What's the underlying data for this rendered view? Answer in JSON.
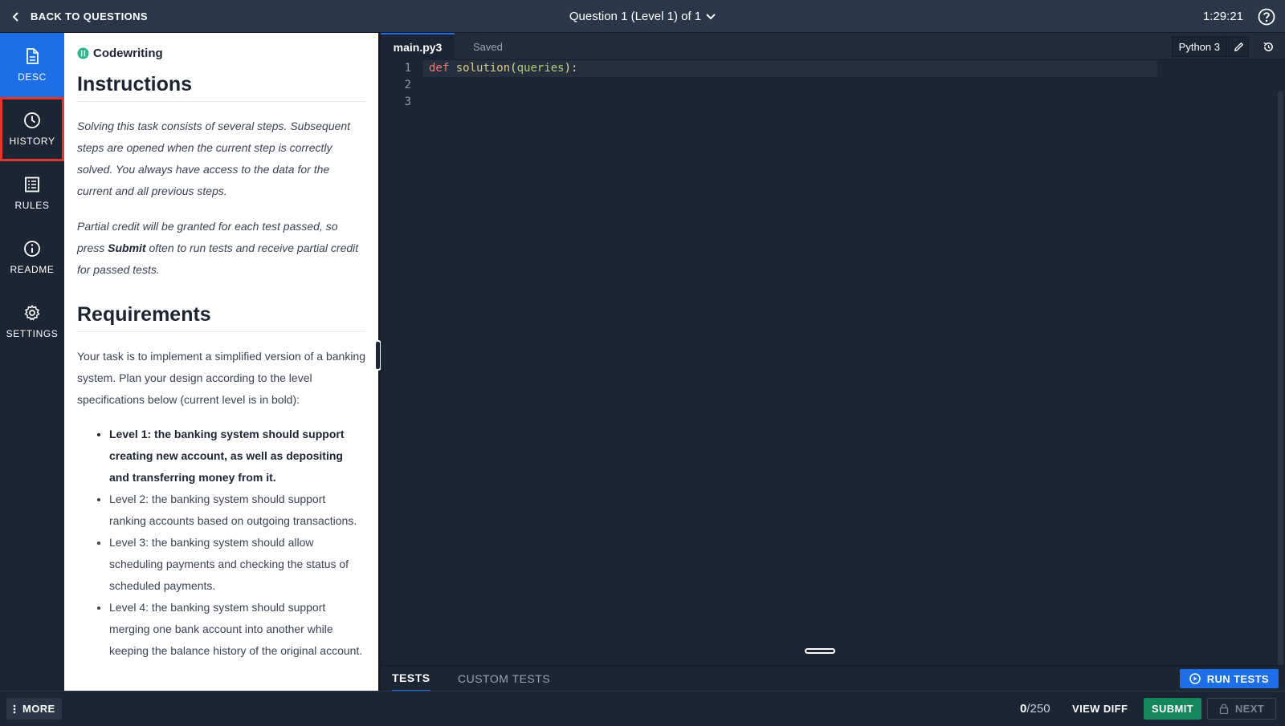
{
  "topbar": {
    "back_label": "BACK TO QUESTIONS",
    "question_title": "Question 1 (Level 1) of 1",
    "timer": "1:29:21"
  },
  "nav": {
    "items": [
      {
        "label": "DESC",
        "icon": "document-icon"
      },
      {
        "label": "HISTORY",
        "icon": "clock-icon"
      },
      {
        "label": "RULES",
        "icon": "list-icon"
      },
      {
        "label": "README",
        "icon": "info-icon"
      },
      {
        "label": "SETTINGS",
        "icon": "gear-icon"
      }
    ]
  },
  "desc": {
    "type_label": "Codewriting",
    "instructions_heading": "Instructions",
    "instructions_p1": "Solving this task consists of several steps. Subsequent steps are opened when the current step is correctly solved. You always have access to the data for the current and all previous steps.",
    "instructions_p2_before": "Partial credit will be granted for each test passed, so press ",
    "instructions_p2_bold": "Submit",
    "instructions_p2_after": " often to run tests and receive partial credit for passed tests.",
    "requirements_heading": "Requirements",
    "requirements_intro": "Your task is to implement a simplified version of a banking system. Plan your design according to the level specifications below (current level is in bold):",
    "levels": [
      "Level 1: the banking system should support creating new account, as well as depositing and transferring money from it.",
      "Level 2: the banking system should support ranking accounts based on outgoing transactions.",
      "Level 3: the banking system should allow scheduling payments and checking the status of scheduled payments.",
      "Level 4: the banking system should support merging one bank account into another while keeping the balance history of the original account."
    ]
  },
  "editor": {
    "filename": "main.py3",
    "save_status": "Saved",
    "language": "Python 3",
    "lines": [
      "1",
      "2",
      "3"
    ],
    "code": {
      "keyword": "def",
      "function": "solution",
      "open_paren": "(",
      "param": "queries",
      "close": "):"
    }
  },
  "tests": {
    "tab_tests": "TESTS",
    "tab_custom": "CUSTOM TESTS",
    "run_label": "RUN TESTS"
  },
  "bottom": {
    "more_label": "MORE",
    "score": "0",
    "score_total": "/250",
    "view_diff": "VIEW DIFF",
    "submit": "SUBMIT",
    "next": "NEXT"
  },
  "colors": {
    "accent": "#1d6fe8",
    "submit": "#15875d",
    "highlight": "#e8352a",
    "background": "#1c2533"
  }
}
